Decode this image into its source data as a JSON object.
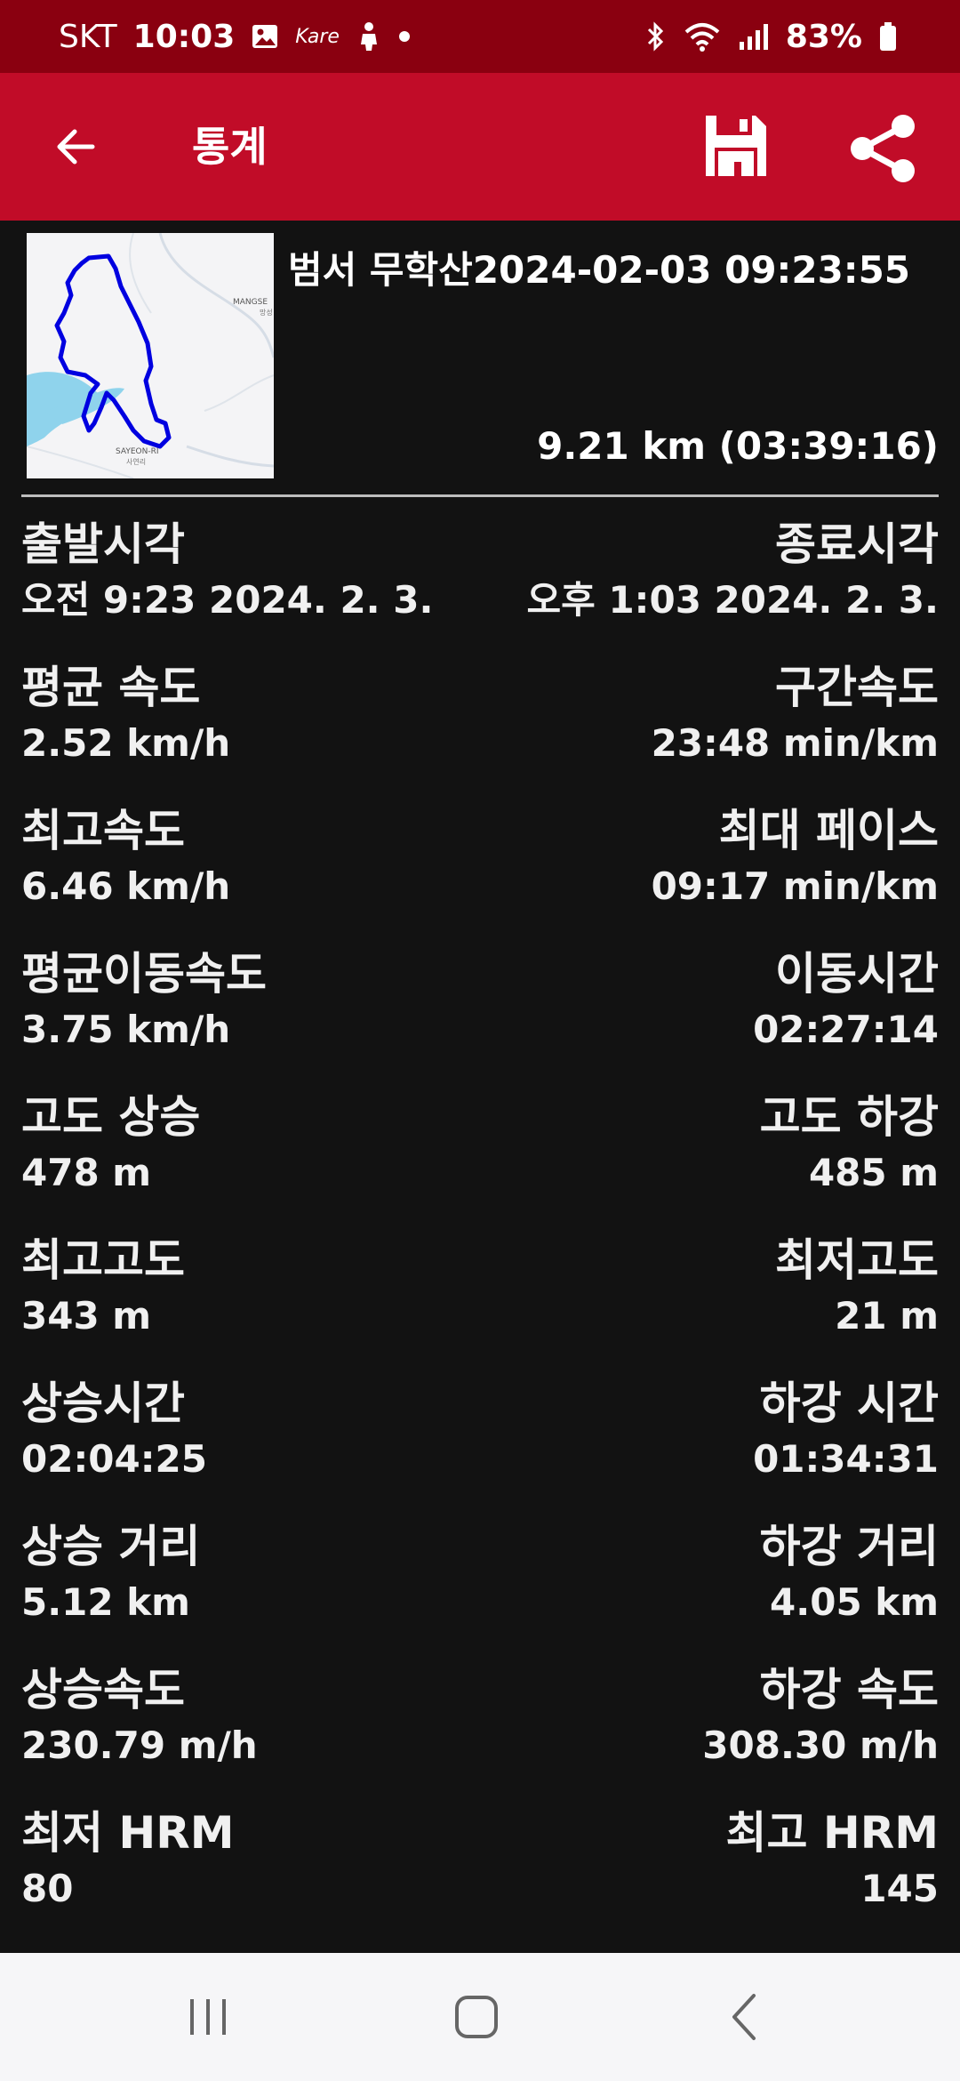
{
  "status_bar": {
    "carrier": "SKT",
    "time": "10:03",
    "app_badge": "Kare",
    "battery": "83%"
  },
  "app_bar": {
    "title": "통계"
  },
  "summary": {
    "map_labels": [
      "MANGSE",
      "망성",
      "SAYEON-RI",
      "사연리"
    ],
    "title": "범서 무학산2024-02-03 09:23:55",
    "distance_time": "9.21 km (03:39:16)"
  },
  "stats": [
    {
      "left_label": "출발시각",
      "left_value": "오전 9:23 2024. 2. 3.",
      "right_label": "종료시각",
      "right_value": "오후 1:03 2024. 2. 3."
    },
    {
      "left_label": "평균 속도",
      "left_value": "2.52 km/h",
      "right_label": "구간속도",
      "right_value": "23:48 min/km"
    },
    {
      "left_label": "최고속도",
      "left_value": "6.46 km/h",
      "right_label": "최대 페이스",
      "right_value": "09:17 min/km"
    },
    {
      "left_label": "평균이동속도",
      "left_value": "3.75 km/h",
      "right_label": "이동시간",
      "right_value": "02:27:14"
    },
    {
      "left_label": "고도 상승",
      "left_value": "478 m",
      "right_label": "고도 하강",
      "right_value": "485 m"
    },
    {
      "left_label": "최고고도",
      "left_value": "343 m",
      "right_label": "최저고도",
      "right_value": "21 m"
    },
    {
      "left_label": "상승시간",
      "left_value": "02:04:25",
      "right_label": "하강 시간",
      "right_value": "01:34:31"
    },
    {
      "left_label": "상승 거리",
      "left_value": "5.12 km",
      "right_label": "하강 거리",
      "right_value": "4.05 km"
    },
    {
      "left_label": "상승속도",
      "left_value": "230.79 m/h",
      "right_label": "하강 속도",
      "right_value": "308.30 m/h"
    },
    {
      "left_label": "최저 HRM",
      "left_value": "80",
      "right_label": "최고 HRM",
      "right_value": "145"
    }
  ],
  "colors": {
    "status_bar": "#8a0010",
    "app_bar": "#c10c28",
    "background": "#121212",
    "track": "#0000e0",
    "water": "#8fd3ec"
  },
  "icons": {
    "back": "arrow-left-icon",
    "save": "floppy-disk-icon",
    "share": "share-icon"
  }
}
